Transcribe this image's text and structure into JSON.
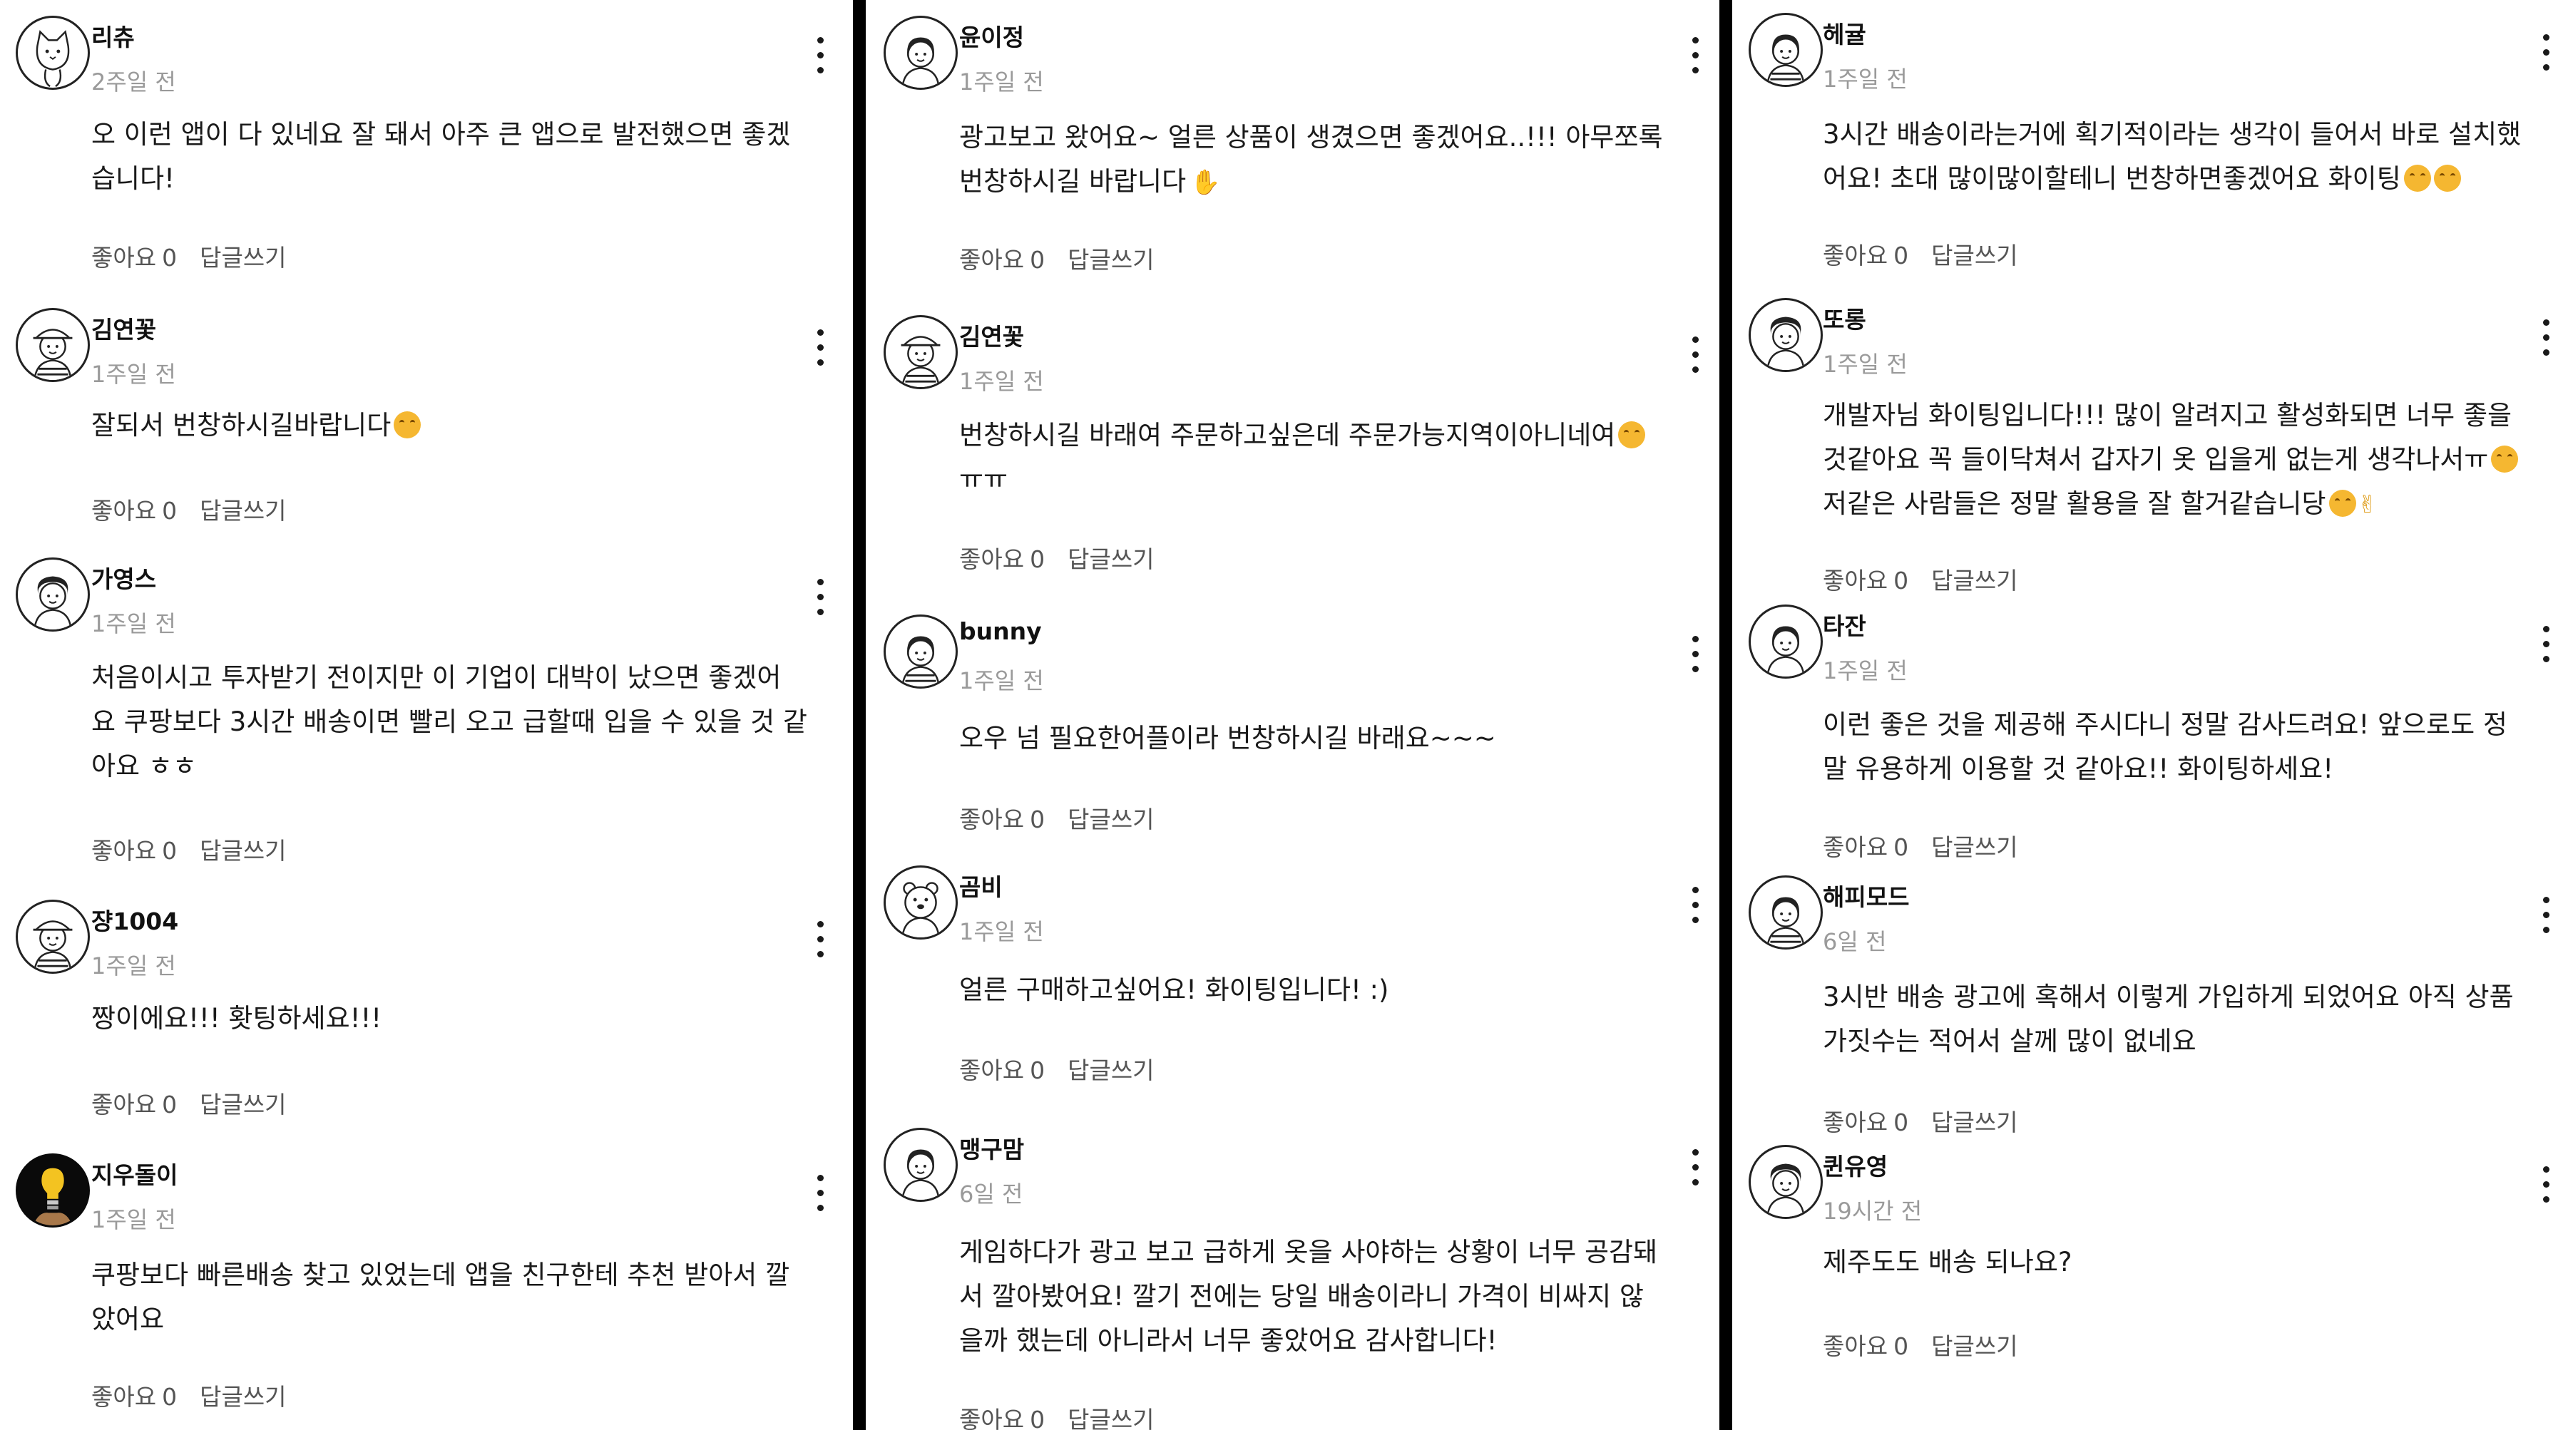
{
  "columns": [
    {
      "comments": [
        {
          "username": "리츄",
          "time": "2주일 전",
          "lines": [
            "오 이런 앱이 다 있네요 잘 돼서 아주 큰 앱으로 발전했으면 좋겠",
            "습니다!"
          ],
          "like_label": "좋아요",
          "like_count": "0",
          "reply_label": "답글쓰기",
          "avatar_icon": "cat-avatar-icon"
        },
        {
          "username": "김연꽃",
          "time": "1주일 전",
          "lines": [
            "잘되서 번창하시길바랍니다"
          ],
          "like_label": "좋아요",
          "like_count": "0",
          "reply_label": "답글쓰기",
          "avatar_icon": "girl-hat-avatar-icon"
        },
        {
          "username": "가영스",
          "time": "1주일 전",
          "lines": [
            "처음이시고 투자받기 전이지만 이 기업이 대박이 났으면 좋겠어",
            "요 쿠팡보다 3시간 배송이면 빨리 오고 급할때 입을 수 있을 것 같",
            "아요 ㅎㅎ"
          ],
          "like_label": "좋아요",
          "like_count": "0",
          "reply_label": "답글쓰기",
          "avatar_icon": "girl-curly-avatar-icon"
        },
        {
          "username": "쟝1004",
          "time": "1주일 전",
          "lines": [
            "짱이에요!!! 홧팅하세요!!!"
          ],
          "like_label": "좋아요",
          "like_count": "0",
          "reply_label": "답글쓰기",
          "avatar_icon": "girl-hat-avatar-icon"
        },
        {
          "username": "지우돌이",
          "time": "1주일 전",
          "lines": [
            "쿠팡보다 빠른배송 찾고 있었는데 앱을 친구한테 추천 받아서 깔",
            "았어요"
          ],
          "like_label": "좋아요",
          "like_count": "0",
          "reply_label": "답글쓰기",
          "avatar_icon": "lightbulb-avatar-icon"
        }
      ]
    },
    {
      "comments": [
        {
          "username": "윤이정",
          "time": "1주일 전",
          "lines": [
            "광고보고 왔어요~ 얼른 상품이 생겼으면 좋겠어요..!!! 아무쪼록",
            "번창하시길 바랍니다"
          ],
          "like_label": "좋아요",
          "like_count": "0",
          "reply_label": "답글쓰기",
          "avatar_icon": "girl-avatar-icon"
        },
        {
          "username": "김연꽃",
          "time": "1주일 전",
          "lines": [
            "번창하시길 바래여 주문하고싶은데 주문가능지역이아니네여",
            "ㅠㅠ"
          ],
          "like_label": "좋아요",
          "like_count": "0",
          "reply_label": "답글쓰기",
          "avatar_icon": "girl-hat-avatar-icon"
        },
        {
          "username": "bunny",
          "time": "1주일 전",
          "lines": [
            "오우 넘 필요한어플이라 번창하시길 바래요~~~"
          ],
          "like_label": "좋아요",
          "like_count": "0",
          "reply_label": "답글쓰기",
          "avatar_icon": "girl-striped-avatar-icon"
        },
        {
          "username": "곰비",
          "time": "1주일 전",
          "lines": [
            "얼른 구매하고싶어요! 화이팅입니다! :)"
          ],
          "like_label": "좋아요",
          "like_count": "0",
          "reply_label": "답글쓰기",
          "avatar_icon": "bear-avatar-icon"
        },
        {
          "username": "맹구맘",
          "time": "6일 전",
          "lines": [
            "게임하다가 광고 보고 급하게 옷을 사야하는 상황이 너무 공감돼",
            "서 깔아봤어요! 깔기 전에는 당일 배송이라니 가격이 비싸지 않",
            "을까 했는데 아니라서 너무 좋았어요 감사합니다!"
          ],
          "like_label": "좋아요",
          "like_count": "0",
          "reply_label": "답글쓰기",
          "avatar_icon": "girl-avatar-icon"
        }
      ]
    },
    {
      "comments": [
        {
          "username": "헤귤",
          "time": "1주일 전",
          "lines": [
            "3시간 배송이라는거에 획기적이라는 생각이 들어서 바로 설치했",
            "어요! 초대 많이많이할테니 번창하면좋겠어요 화이팅"
          ],
          "like_label": "좋아요",
          "like_count": "0",
          "reply_label": "답글쓰기",
          "avatar_icon": "girl-striped-avatar-icon"
        },
        {
          "username": "또롱",
          "time": "1주일 전",
          "lines": [
            "개발자님 화이팅입니다!!! 많이 알려지고 활성화되면 너무 좋을",
            "것같아요 꼭 들이닥쳐서 갑자기 옷 입을게 없는게 생각나서ㅠ",
            "저같은 사람들은 정말 활용을 잘 할거같습니당"
          ],
          "like_label": "좋아요",
          "like_count": "0",
          "reply_label": "답글쓰기",
          "avatar_icon": "girl-curly-avatar-icon"
        },
        {
          "username": "타잔",
          "time": "1주일 전",
          "lines": [
            "이런 좋은 것을 제공해 주시다니 정말 감사드려요! 앞으로도 정",
            "말 유용하게 이용할 것 같아요!! 화이팅하세요!"
          ],
          "like_label": "좋아요",
          "like_count": "0",
          "reply_label": "답글쓰기",
          "avatar_icon": "girl-avatar-icon"
        },
        {
          "username": "해피모드",
          "time": "6일 전",
          "lines": [
            "3시반 배송 광고에 혹해서 이렇게 가입하게 되었어요 아직 상품",
            "가짓수는 적어서 살께 많이 없네요"
          ],
          "like_label": "좋아요",
          "like_count": "0",
          "reply_label": "답글쓰기",
          "avatar_icon": "girl-striped-avatar-icon"
        },
        {
          "username": "퀸유영",
          "time": "19시간 전",
          "lines": [
            "제주도도 배송 되나요?"
          ],
          "like_label": "좋아요",
          "like_count": "0",
          "reply_label": "답글쓰기",
          "avatar_icon": "girl-curly-avatar-icon"
        }
      ]
    }
  ],
  "colors": {
    "username": "#111111",
    "timestamp": "#9a9a9a",
    "body": "#1a1a1a",
    "actions": "#555555",
    "divider": "#000000"
  }
}
